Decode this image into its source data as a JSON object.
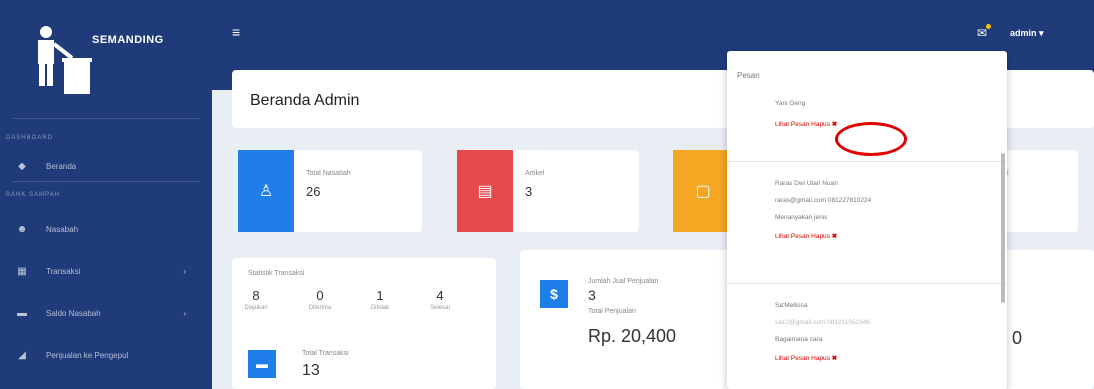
{
  "brand": {
    "name": "SEMANDING"
  },
  "sidebar": {
    "heading1": "DASHBOARD",
    "heading2": "BANK SAMPAH",
    "items": [
      {
        "label": "Beranda",
        "icon": "dashboard-icon"
      },
      {
        "label": "Nasabah",
        "icon": "users-icon"
      },
      {
        "label": "Transaksi",
        "icon": "transaction-icon",
        "arrow": "›"
      },
      {
        "label": "Saldo Nasabah",
        "icon": "wallet-icon",
        "arrow": "›"
      },
      {
        "label": "Penjualan ke Pengepul",
        "icon": "chart-icon"
      }
    ]
  },
  "topbar": {
    "menu_icon": "≡",
    "user": "admin ▾"
  },
  "page": {
    "title": "Beranda Admin"
  },
  "stats": [
    {
      "label": "Total Nasabah",
      "value": "26",
      "color": "#1f7ee8",
      "icon": "user-icon"
    },
    {
      "label": "Artikel",
      "value": "3",
      "color": "#e74a4a",
      "icon": "article-icon"
    },
    {
      "label": "",
      "value": "",
      "color": "#f5a623",
      "icon": "document-icon"
    },
    {
      "label": "ssi",
      "value": ""
    }
  ],
  "transaksi": {
    "title": "Statistik Transaksi",
    "items": [
      {
        "n": "8",
        "t": "Diajukan"
      },
      {
        "n": "0",
        "t": "Diterima"
      },
      {
        "n": "1",
        "t": "Ditolak"
      },
      {
        "n": "4",
        "t": "Selesai"
      }
    ],
    "total_label": "Total Transaksi",
    "total_value": "13"
  },
  "penjualan": {
    "title": "Jumlah Jual Penjualan",
    "count": "3",
    "total_label": "Total Penjualan",
    "total_value": "Rp. 20,400"
  },
  "right_card": {
    "value": "0"
  },
  "dropdown": {
    "header": "Pesan",
    "messages": [
      {
        "name": "Yani Geng",
        "line2": "",
        "line3": "",
        "actions": "Lihat Pesan   Hapus",
        "x": "✖"
      },
      {
        "name": "Raras Dwi Utari Nuari",
        "line2": "raras@gmail.com 081227810224",
        "line3": "Menanyakan jenis",
        "actions": "Lihat Pesan   Hapus",
        "x": "✖"
      },
      {
        "name": "Sa'Mellissa",
        "line2": "sa12@gmail.com 081211052346",
        "line3": "Bagaimana cara",
        "actions": "Lihat Pesan   Hapus",
        "x": "✖"
      }
    ]
  }
}
